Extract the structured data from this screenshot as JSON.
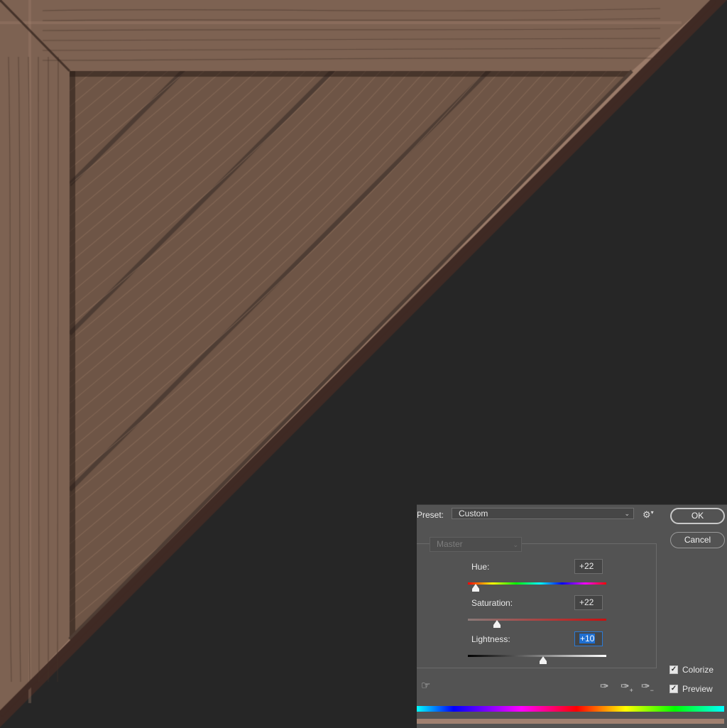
{
  "dialog": {
    "preset_label": "Preset:",
    "preset_value": "Custom",
    "ok_label": "OK",
    "cancel_label": "Cancel",
    "channel": "Master",
    "hue": {
      "label": "Hue:",
      "value": "+22"
    },
    "saturation": {
      "label": "Saturation:",
      "value": "+22"
    },
    "lightness": {
      "label": "Lightness:",
      "value": "+10"
    },
    "colorize": {
      "label": "Colorize",
      "checked": true
    },
    "preview": {
      "label": "Preview",
      "checked": true
    }
  },
  "icons": {
    "gear": "gear-icon",
    "hand": "on-image-adjust-icon",
    "eyedropper": "eyedropper-icon",
    "eyedropper_add": "eyedropper-plus-icon",
    "eyedropper_subtract": "eyedropper-minus-icon"
  },
  "colors": {
    "background": "#262626",
    "wood": "#7d6252",
    "wood_dark": "#4e3d34",
    "wood_light": "#9a7b69",
    "edge": "#3f2a24",
    "dialog_bg": "#535353",
    "result_strip": "#a08070"
  }
}
